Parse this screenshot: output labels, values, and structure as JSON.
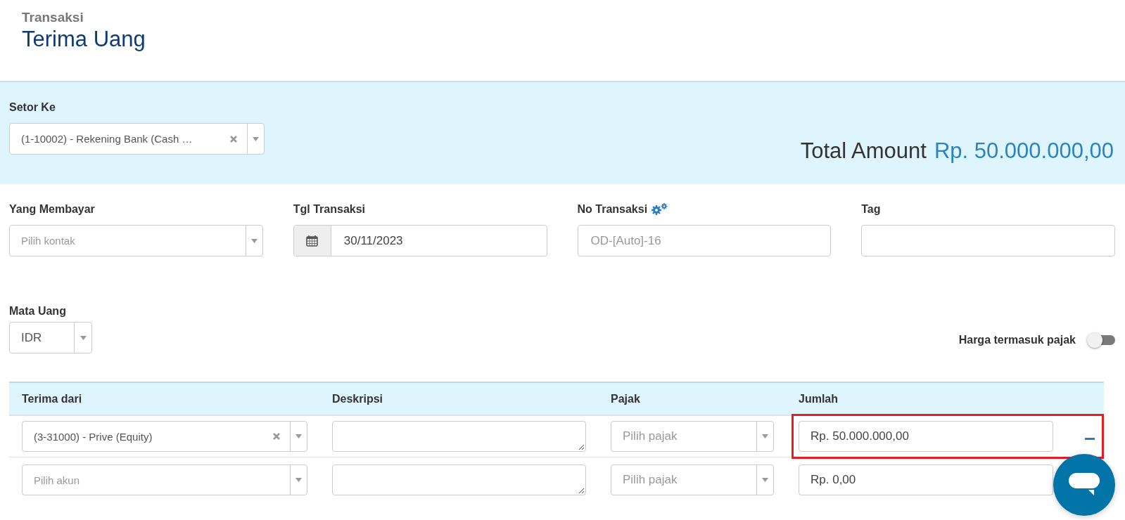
{
  "header": {
    "breadcrumb": "Transaksi",
    "title": "Terima Uang"
  },
  "deposit": {
    "label": "Setor Ke",
    "value": "(1-10002) - Rekening Bank (Cash …",
    "total_label": "Total Amount",
    "total_value": "Rp. 50.000.000,00"
  },
  "fields": [
    {
      "kind": "select",
      "label": "Yang Membayar",
      "placeholder": "Pilih kontak",
      "settings": false
    },
    {
      "kind": "date",
      "label": "Tgl Transaksi",
      "value": "30/11/2023",
      "settings": false
    },
    {
      "kind": "text",
      "label": "No Transaksi",
      "placeholder": "OD-[Auto]-16",
      "settings": true
    },
    {
      "kind": "text",
      "label": "Tag",
      "settings": false
    }
  ],
  "currency": {
    "label": "Mata Uang",
    "value": "IDR"
  },
  "tax_inclusive": {
    "label": "Harga termasuk pajak",
    "on": false
  },
  "table": {
    "columns": [
      "Terima dari",
      "Deskripsi",
      "Pajak",
      "Jumlah"
    ],
    "rows": [
      {
        "account": {
          "value": "(3-31000) - Prive (Equity)"
        },
        "tax": {
          "placeholder": "Pilih pajak"
        },
        "amount": "Rp. 50.000.000,00",
        "highlighted": true,
        "removable": true
      },
      {
        "account": {
          "placeholder": "Pilih akun"
        },
        "tax": {
          "placeholder": "Pilih pajak"
        },
        "amount": "Rp. 0,00",
        "highlighted": false,
        "removable": false
      }
    ]
  }
}
